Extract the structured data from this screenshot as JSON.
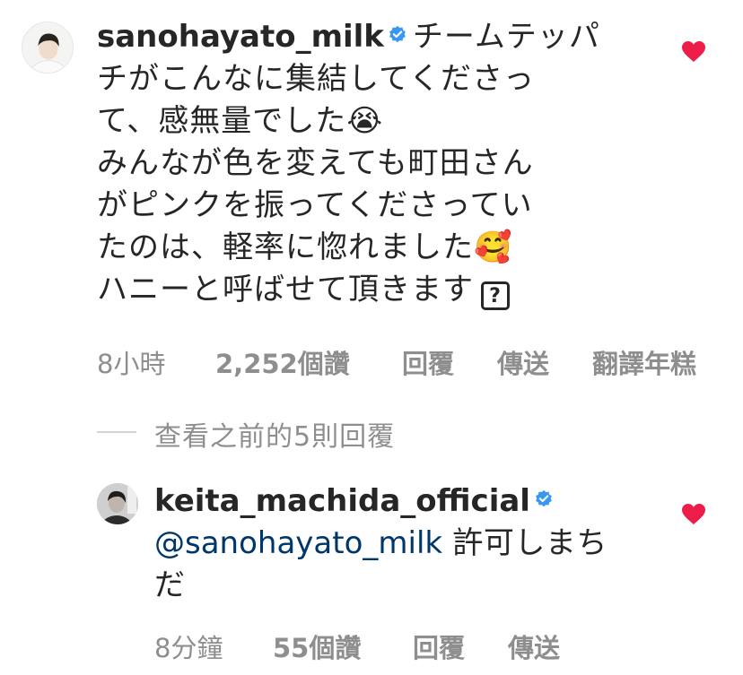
{
  "comment": {
    "username": "sanohayato_milk",
    "text_lines": [
      "チームテッパ",
      "チがこんなに集結してくださっ",
      "て、感無量でした",
      "みんなが色を変えても町田さん",
      "がピンクを振ってくださってい",
      "たのは、軽率に惚れました",
      "ハニーと呼ばせて頂きます"
    ],
    "emojis": [
      "😭",
      "🥰"
    ],
    "unknown_glyph": "?",
    "time": "8小時",
    "likes": "2,252個讚",
    "reply_label": "回覆",
    "send_label": "傳送",
    "translate_label": "翻譯年糕",
    "liked": true
  },
  "view_replies": "查看之前的5則回覆",
  "reply": {
    "username": "keita_machida_official",
    "mention": "@sanohayato_milk",
    "text_line1": "許可しまち",
    "text_line2": "だ",
    "time": "8分鐘",
    "likes": "55個讚",
    "reply_label": "回覆",
    "send_label": "傳送",
    "liked": true
  },
  "colors": {
    "text": "#262626",
    "secondary": "#8e8e8e",
    "heart": "#ed1d49",
    "verified": "#3897f0",
    "mention": "#00376b"
  },
  "icons": [
    "avatar",
    "verified-badge-icon",
    "heart-icon"
  ]
}
